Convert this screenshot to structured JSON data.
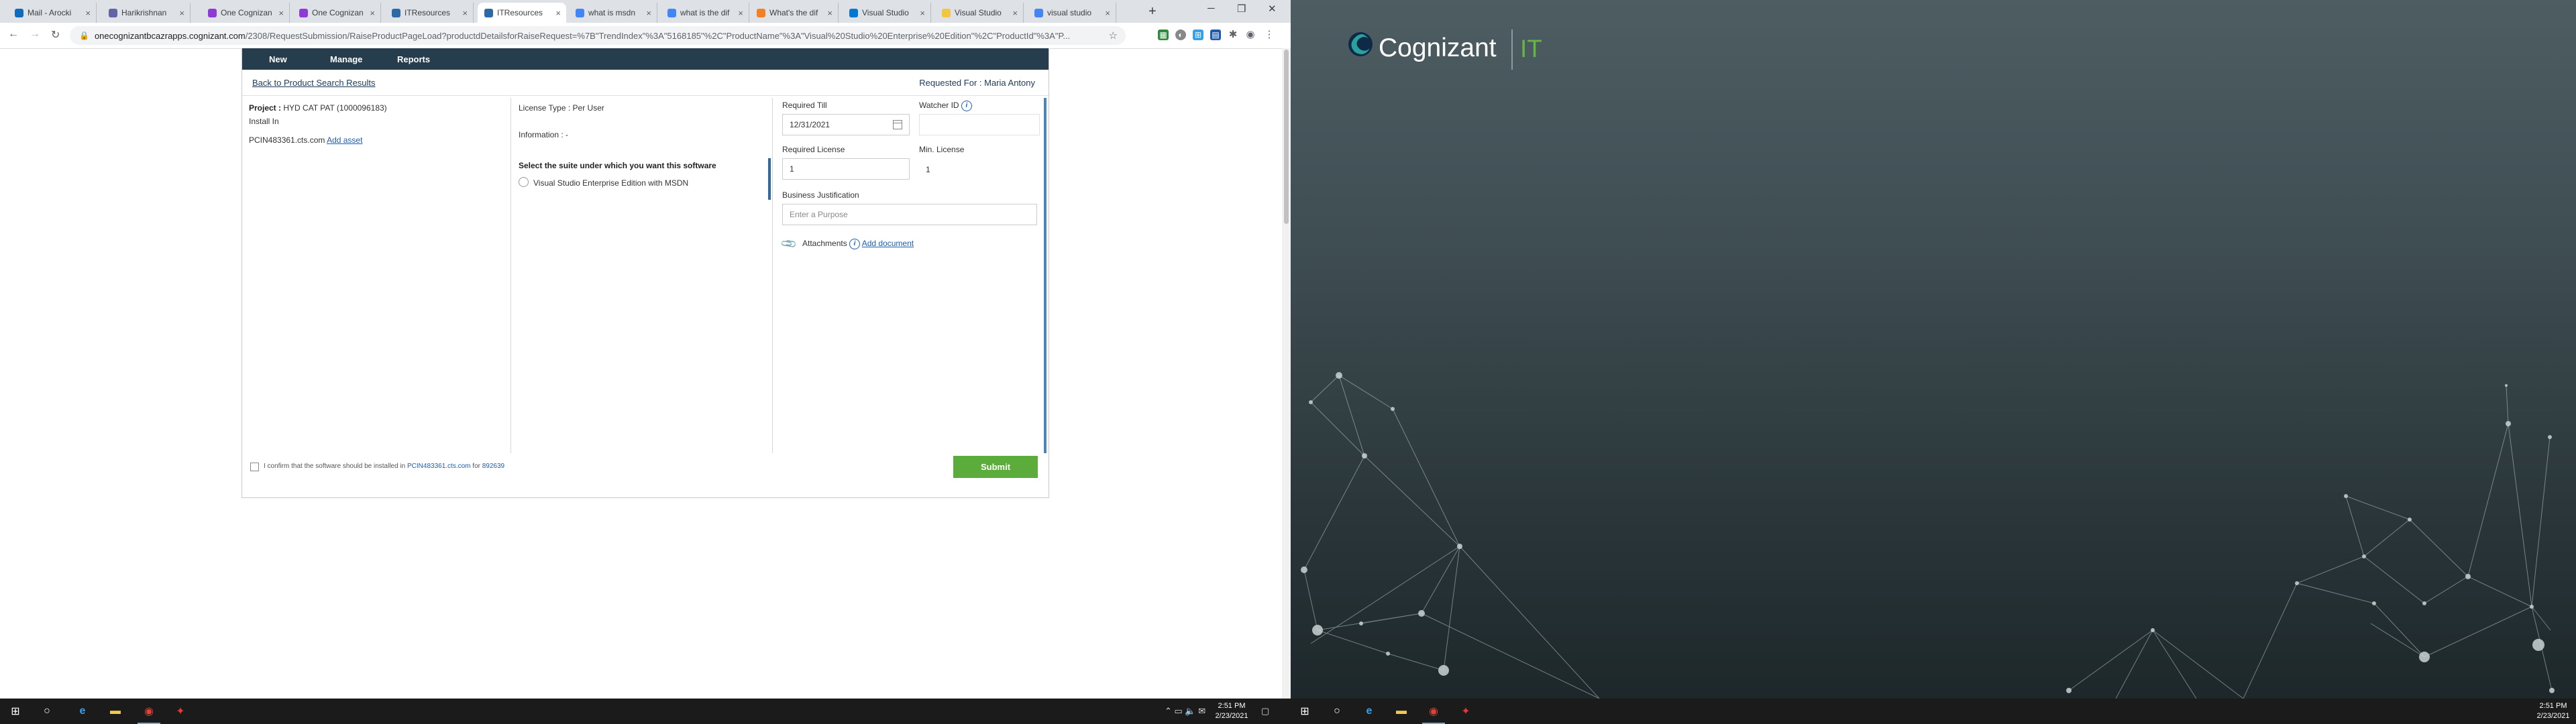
{
  "browser": {
    "tabs": [
      {
        "label": "Mail - Arocki",
        "color": "#0f6cbd"
      },
      {
        "label": "Harikrishnan",
        "color": "#6264a7"
      },
      {
        "label": "One Cognizan",
        "color": "#8e3bd6"
      },
      {
        "label": "One Cognizan",
        "color": "#8e3bd6"
      },
      {
        "label": "ITResources",
        "color": "#2b6aa6"
      },
      {
        "label": "ITResources",
        "color": "#2b6aa6"
      },
      {
        "label": "what is msdn",
        "color": "#4285f4"
      },
      {
        "label": "what is the dif",
        "color": "#4285f4"
      },
      {
        "label": "What's the dif",
        "color": "#f48024"
      },
      {
        "label": "Visual Studio",
        "color": "#0078d4"
      },
      {
        "label": "Visual Studio",
        "color": "#f3c63f"
      },
      {
        "label": "visual studio",
        "color": "#4285f4"
      }
    ],
    "active_tab": 5,
    "url_host": "onecognizantbcazrapps.cognizant.com",
    "url_path": "/2308/RequestSubmission/RaiseProductPageLoad?productdDetailsforRaiseRequest=%7B\"TrendIndex\"%3A\"5168185\"%2C\"ProductName\"%3A\"Visual%20Studio%20Enterprise%20Edition\"%2C\"ProductId\"%3A\"P..."
  },
  "nav": {
    "items": [
      "New",
      "Manage",
      "Reports"
    ]
  },
  "subheader": {
    "back_link": "Back to Product Search Results",
    "requested_for_label": "Requested For :",
    "requested_for_name": "Maria Antony"
  },
  "left": {
    "project_label": "Project :",
    "project_value": "HYD CAT PAT (1000096183)",
    "install_in_label": "Install In",
    "asset": "PCIN483361.cts.com",
    "add_asset": "Add asset"
  },
  "middle": {
    "license_type_label": "License Type :",
    "license_type_value": "Per User",
    "information_label": "Information :",
    "information_value": "-",
    "suite_prompt": "Select the suite under which you want this software",
    "suite_option": "Visual Studio Enterprise Edition with MSDN"
  },
  "right": {
    "required_till_label": "Required Till",
    "required_till_value": "12/31/2021",
    "watcher_label": "Watcher ID",
    "required_license_label": "Required License",
    "required_license_value": "1",
    "min_license_label": "Min. License",
    "min_license_value": "1",
    "business_justification_label": "Business Justification",
    "purpose_placeholder": "Enter a Purpose",
    "attachments_label": "Attachments",
    "add_document": "Add document"
  },
  "footer": {
    "confirm_prefix": "I confirm that the software should be installed in",
    "confirm_machine": "PCIN483361.cts.com",
    "confirm_for": "for",
    "confirm_id": "892639",
    "submit": "Submit"
  },
  "taskbar": {
    "time": "2:51 PM",
    "date": "2/23/2021"
  },
  "wallpaper": {
    "brand": "Cognizant",
    "suffix": "IT"
  }
}
